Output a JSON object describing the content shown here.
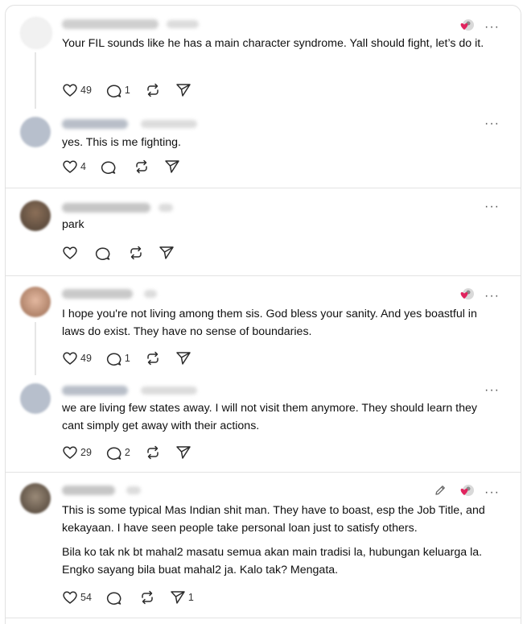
{
  "ui": {
    "more_label": "···"
  },
  "comments": [
    {
      "text": "Your FIL sounds like he has a main character syndrome. Yall should fight, let’s do it.",
      "likes": "49",
      "replies": "1",
      "shares": ""
    },
    {
      "text": "yes. This is me fighting.",
      "likes": "4",
      "replies": "",
      "shares": ""
    },
    {
      "text": "park",
      "likes": "",
      "replies": "",
      "shares": ""
    },
    {
      "text": "I hope you're not living among them sis. God bless your sanity. And yes boastful in laws do exist. They have no sense of boundaries.",
      "likes": "49",
      "replies": "1",
      "shares": ""
    },
    {
      "text": "we are living few states away. I will not visit them anymore. They should learn they cant simply get away with their actions.",
      "likes": "29",
      "replies": "2",
      "shares": ""
    },
    {
      "text": "This is some typical Mas Indian shit man. They have to boast, esp the Job Title, and kekayaan. I have seen people take personal loan just to satisfy others.",
      "text2": "Bila ko tak nk bt mahal2 masatu semua akan main tradisi la, hubungan keluarga la. Engko sayang bila buat mahal2 ja. Kalo tak? Mengata.",
      "likes": "54",
      "replies": "",
      "shares": "1"
    }
  ],
  "colors": {
    "liked_heart": "#e0245e",
    "icon": "#2b2b2b",
    "divider": "#e3e3e3"
  }
}
